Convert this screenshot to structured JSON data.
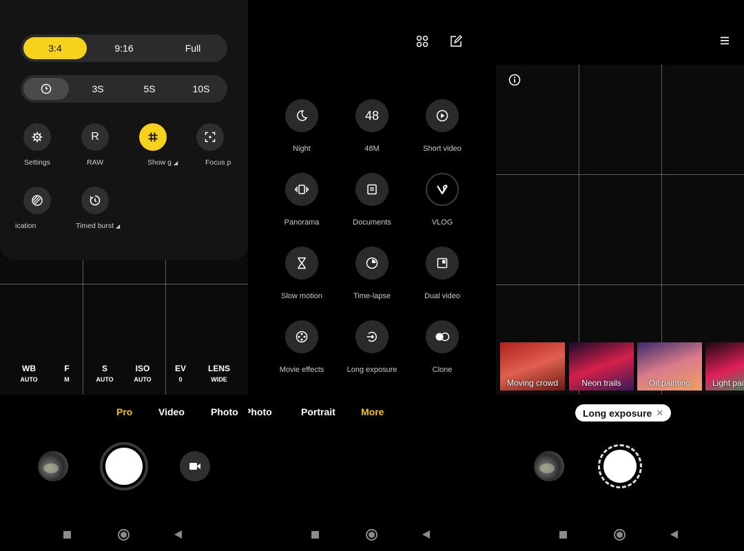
{
  "panel1": {
    "aspect_ratios": [
      {
        "label": "3:4",
        "selected": true
      },
      {
        "label": "9:16",
        "selected": false
      },
      {
        "label": "Full",
        "selected": false
      }
    ],
    "timer_options": [
      {
        "label": "",
        "icon": "timer-icon",
        "selected": true
      },
      {
        "label": "3S",
        "selected": false
      },
      {
        "label": "5S",
        "selected": false
      },
      {
        "label": "10S",
        "selected": false
      }
    ],
    "quick_buttons": [
      {
        "label": "Settings",
        "icon": "gear-icon"
      },
      {
        "label": "RAW",
        "glyph": "R"
      },
      {
        "label": "Show g",
        "icon": "grid-icon",
        "active": true
      },
      {
        "label": "Focus p",
        "icon": "focus-icon"
      },
      {
        "label": "ication",
        "icon": "stripes-icon"
      },
      {
        "label": "Timed burst",
        "icon": "timed-burst-icon"
      }
    ],
    "pro_params": [
      {
        "name": "WB",
        "value": "AUTO"
      },
      {
        "name": "F",
        "value": "M"
      },
      {
        "name": "S",
        "value": "AUTO"
      },
      {
        "name": "ISO",
        "value": "AUTO"
      },
      {
        "name": "EV",
        "value": "0"
      },
      {
        "name": "LENS",
        "value": "WIDE"
      }
    ],
    "modes": [
      {
        "label": "Pro",
        "active": true
      },
      {
        "label": "Video",
        "active": false
      },
      {
        "label": "Photo",
        "active": false
      }
    ]
  },
  "panel2": {
    "mode_bar_partial": [
      {
        "label": "Photo",
        "active": false
      },
      {
        "label": "Portrait",
        "active": false
      },
      {
        "label": "More",
        "active": true
      }
    ],
    "grid": [
      {
        "label": "Night",
        "icon": "moon-icon"
      },
      {
        "label": "48M",
        "glyph": "48"
      },
      {
        "label": "Short video",
        "icon": "play-icon"
      },
      {
        "label": "Panorama",
        "icon": "panorama-icon"
      },
      {
        "label": "Documents",
        "icon": "document-icon"
      },
      {
        "label": "VLOG",
        "icon": "vlog-icon"
      },
      {
        "label": "Slow motion",
        "icon": "hourglass-icon"
      },
      {
        "label": "Time-lapse",
        "icon": "timelapse-icon"
      },
      {
        "label": "Dual video",
        "icon": "dual-video-icon"
      },
      {
        "label": "Movie effects",
        "icon": "film-reel-icon"
      },
      {
        "label": "Long exposure",
        "icon": "long-exposure-icon"
      },
      {
        "label": "Clone",
        "icon": "clone-icon"
      }
    ]
  },
  "panel3": {
    "effects": [
      {
        "label": "Moving crowd",
        "selected": true,
        "colors": [
          "#b0201c",
          "#e06050",
          "#6a1a14"
        ]
      },
      {
        "label": "Neon trails",
        "selected": false,
        "colors": [
          "#1a0a2a",
          "#d4204a",
          "#3a1a55"
        ]
      },
      {
        "label": "Oil painting",
        "selected": false,
        "colors": [
          "#3a2a6a",
          "#d97b8a",
          "#f0a060"
        ]
      },
      {
        "label": "Light pai",
        "selected": false,
        "colors": [
          "#1a0a10",
          "#e0205a",
          "#20a060"
        ]
      }
    ],
    "active_effect_tag": "Long exposure"
  },
  "colors": {
    "accent_yellow": "#f7d21c",
    "mode_active": "#f7c21c"
  }
}
